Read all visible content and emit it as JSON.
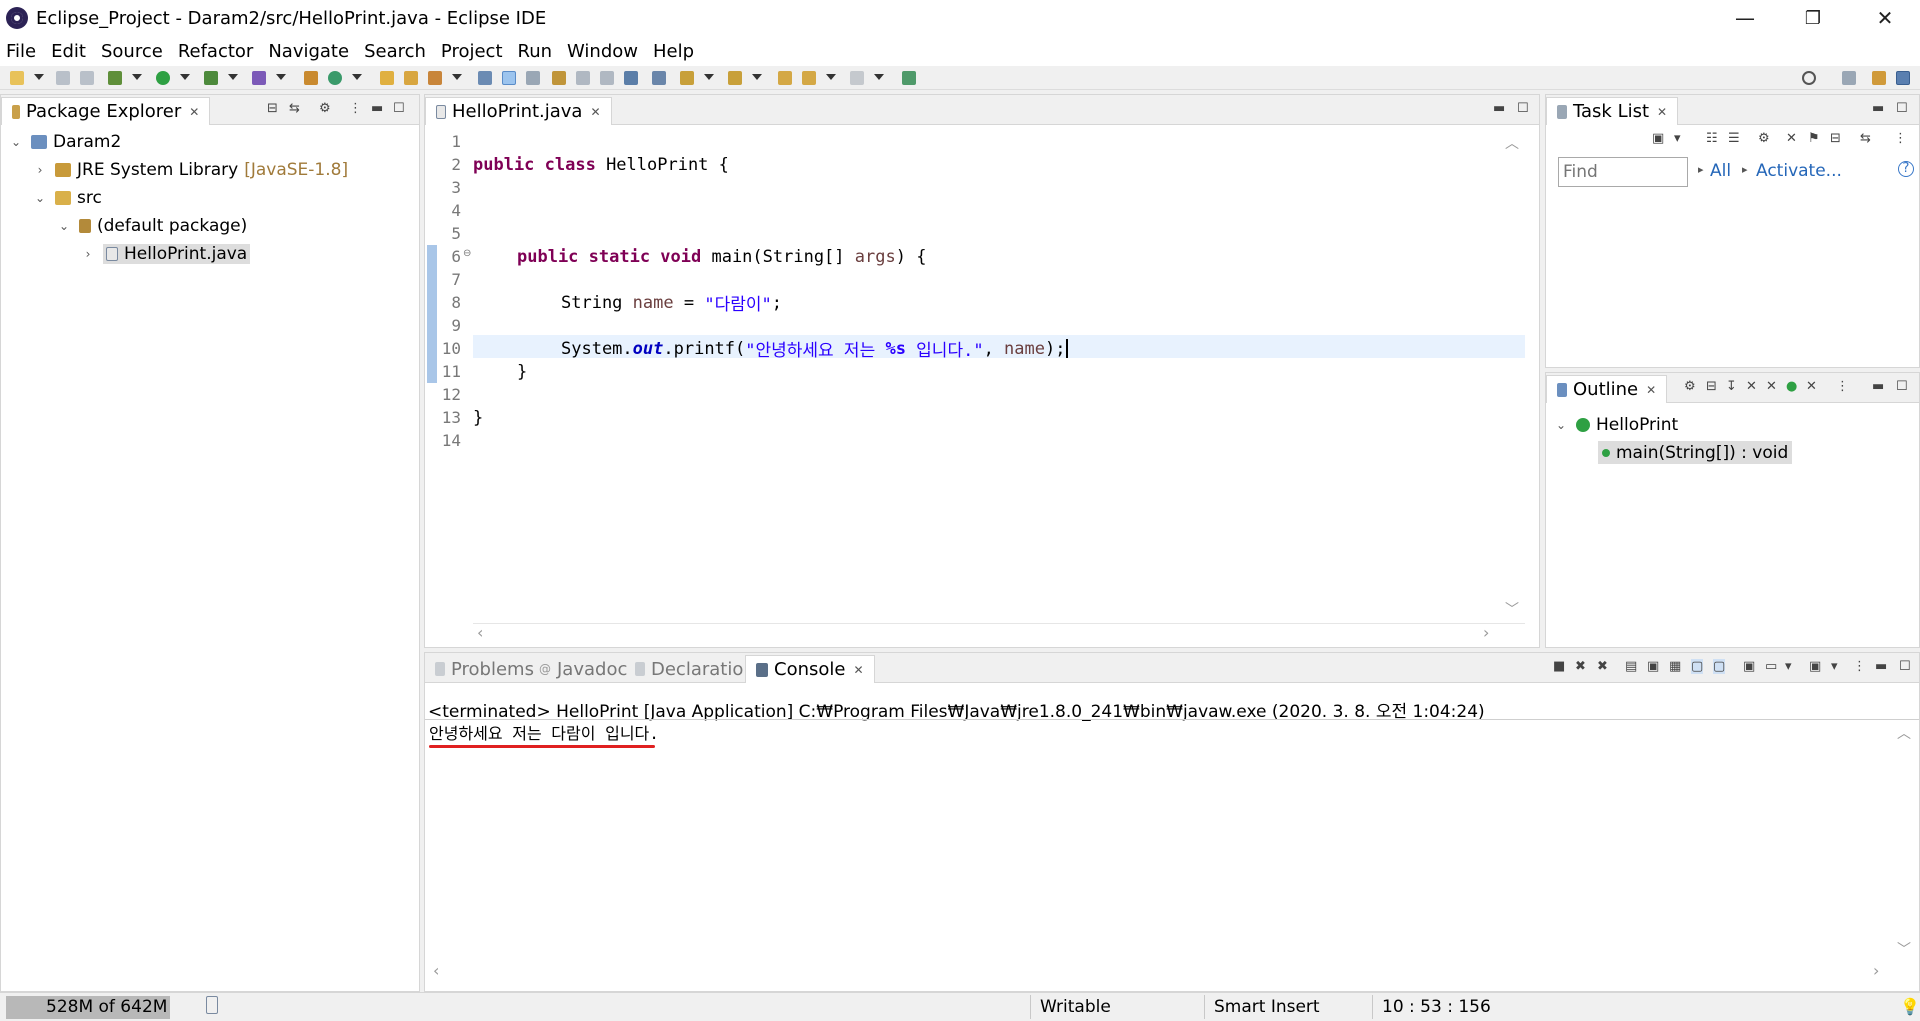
{
  "window": {
    "title": "Eclipse_Project - Daram2/src/HelloPrint.java - Eclipse IDE",
    "minimize": "—",
    "maximize": "❐",
    "close": "✕"
  },
  "menu": [
    "File",
    "Edit",
    "Source",
    "Refactor",
    "Navigate",
    "Search",
    "Project",
    "Run",
    "Window",
    "Help"
  ],
  "package_explorer": {
    "tab": "Package Explorer",
    "tree": [
      {
        "label": "Daram2",
        "extra": ""
      },
      {
        "label": "JRE System Library",
        "extra": "[JavaSE-1.8]"
      },
      {
        "label": "src",
        "extra": ""
      },
      {
        "label": "(default package)",
        "extra": ""
      },
      {
        "label": "HelloPrint.java",
        "extra": ""
      }
    ]
  },
  "editor": {
    "tab": "HelloPrint.java",
    "line_numbers": [
      "1",
      "2",
      "3",
      "4",
      "5",
      "6",
      "7",
      "8",
      "9",
      "10",
      "11",
      "12",
      "13",
      "14"
    ],
    "code": {
      "l2_kw": "public class",
      "l2_rest": " HelloPrint {",
      "l6_kw": "public static void",
      "l6_rest1": " main(String[] ",
      "l6_var": "args",
      "l6_rest2": ") {",
      "l8_type": "String ",
      "l8_var": "name",
      "l8_eq": " = ",
      "l8_str": "\"다람이\"",
      "l8_end": ";",
      "l10_sys": "System.",
      "l10_out": "out",
      "l10_printf": ".printf(",
      "l10_str1": "\"안녕하세요 저는 ",
      "l10_fmt": "%s",
      "l10_str2": " 입니다.\"",
      "l10_comma": ", ",
      "l10_var": "name",
      "l10_end": ");",
      "l11": "}",
      "l13": "}"
    }
  },
  "task_list": {
    "tab": "Task List",
    "find_placeholder": "Find",
    "all": "All",
    "activate": "Activate..."
  },
  "outline": {
    "tab": "Outline",
    "class_name": "HelloPrint",
    "method": "main(String[]) : void"
  },
  "bottom_tabs": [
    "Problems",
    "Javadoc",
    "Declaration",
    "Console"
  ],
  "console": {
    "header": "<terminated> HelloPrint [Java Application] C:₩Program Files₩Java₩jre1.8.0_241₩bin₩javaw.exe (2020. 3. 8. 오전 1:04:24)",
    "output": "안녕하세요 저는 다람이 입니다."
  },
  "status": {
    "memory": "528M of 642M",
    "writable": "Writable",
    "insert_mode": "Smart Insert",
    "position": "10 : 53 : 156"
  }
}
